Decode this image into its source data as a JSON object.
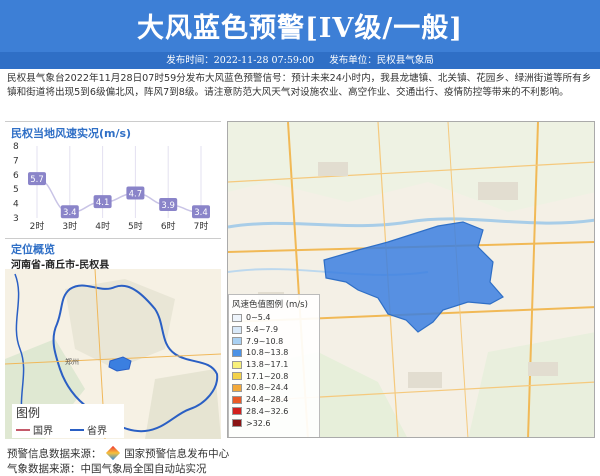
{
  "banner": {
    "title": "大风蓝色预警[IV级/一般]"
  },
  "meta": {
    "publish_time": "发布时间：2022-11-28 07:59:00",
    "publish_unit": "发布单位：民权县气象局"
  },
  "description": "民权县气象台2022年11月28日07时59分发布大风蓝色预警信号：预计未来24小时内，我县龙塘镇、北关镇、花园乡、绿洲街道等所有乡镇和街道将出现5到6级偏北风，阵风7到8级。请注意防范大风天气对设施农业、高空作业、交通出行、疫情防控等带来的不利影响。",
  "wind_panel": {
    "title": "民权当地风速实况(m/s)"
  },
  "chart_data": {
    "type": "line",
    "title": "民权当地风速实况(m/s)",
    "categories": [
      "2时",
      "3时",
      "4时",
      "5时",
      "6时",
      "7时"
    ],
    "values": [
      5.7,
      3.4,
      4.1,
      4.7,
      3.9,
      3.4
    ],
    "y_ticks": [
      "8",
      "7",
      "6",
      "5",
      "4",
      "3"
    ],
    "ylim": [
      3,
      8
    ],
    "value_labels": [
      "5.7",
      "3.4",
      "4.1",
      "4.7",
      "3.9",
      "3.4"
    ],
    "colors": {
      "line": "#c9c4e6",
      "label_bg": "#8a84c9"
    }
  },
  "location": {
    "title": "定位概览",
    "subtitle": "河南省-商丘市-民权县",
    "city_label": "郑州"
  },
  "mini_legend": {
    "title": "图例",
    "items": [
      {
        "label": "国界",
        "color": "#c45a6a"
      },
      {
        "label": "省界",
        "color": "#2a5fc4"
      }
    ]
  },
  "map_legend": {
    "title": "风速色值图例 (m/s)",
    "items": [
      {
        "label": "0~5.4",
        "color": "#eef4fb"
      },
      {
        "label": "5.4~7.9",
        "color": "#d8e8f8"
      },
      {
        "label": "7.9~10.8",
        "color": "#a9d0f2"
      },
      {
        "label": "10.8~13.8",
        "color": "#4c92e6"
      },
      {
        "label": "13.8~17.1",
        "color": "#f7ef7a"
      },
      {
        "label": "17.1~20.8",
        "color": "#f3d24a"
      },
      {
        "label": "20.8~24.4",
        "color": "#f2a93a"
      },
      {
        "label": "24.4~28.4",
        "color": "#ea5a26"
      },
      {
        "label": "28.4~32.6",
        "color": "#d1201e"
      },
      {
        "label": ">32.6",
        "color": "#8a1414"
      }
    ]
  },
  "footer": {
    "source_label": "预警信息数据来源：",
    "source_name": "国家预警信息发布中心",
    "line2": "气象数据来源：中国气象局全国自动站实况"
  }
}
